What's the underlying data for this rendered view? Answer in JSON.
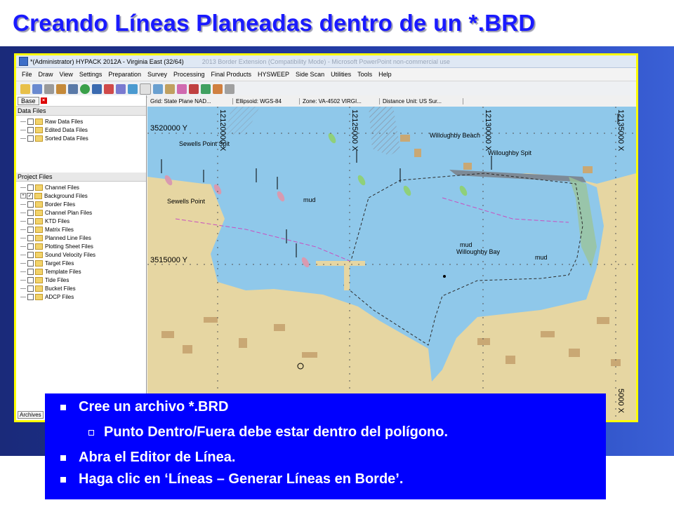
{
  "slide": {
    "title": "Creando Líneas Planeadas dentro de un *.BRD"
  },
  "window": {
    "title": "*(Administrator) HYPACK 2012A - Virginia East (32/64)",
    "background_caption": "2013 Border Extension (Compatibility Mode) - Microsoft PowerPoint non-commercial use"
  },
  "menu": [
    "File",
    "Draw",
    "View",
    "Settings",
    "Preparation",
    "Survey",
    "Processing",
    "Final Products",
    "HYSWEEP",
    "Side Scan",
    "Utilities",
    "Tools",
    "Help"
  ],
  "sidebar": {
    "tab_label": "Base",
    "data_files_label": "Data Files",
    "data_files": [
      "Raw Data Files",
      "Edited Data Files",
      "Sorted Data Files"
    ],
    "project_files_label": "Project Files",
    "project_files": [
      "Channel Files",
      "Background Files",
      "Border Files",
      "Channel Plan Files",
      "KTD Files",
      "Matrix Files",
      "Planned Line Files",
      "Plotting Sheet Files",
      "Sound Velocity Files",
      "Target Files",
      "Template Files",
      "Tide Files",
      "Bucket Files",
      "ADCP Files"
    ],
    "archives_tab": "Archives"
  },
  "statusbar": {
    "grid": "Grid: State Plane NAD...",
    "ellipsoid": "Ellipsoid: WGS-84",
    "zone": "Zone: VA-4502 VIRGI...",
    "distance_unit": "Distance Unit: US Sur..."
  },
  "map": {
    "y_labels": [
      "3520000 Y",
      "3515000 Y"
    ],
    "x_labels": [
      "12120000 X",
      "12125000 X",
      "12130000 X",
      "12135000 X"
    ],
    "x_label_bottom": "5000 X",
    "place_labels": [
      "Sewells Point Spit",
      "Willoughby Beach",
      "Willoughby Spit",
      "Sewells Point",
      "mud",
      "mud",
      "Willoughby Bay",
      "mud"
    ],
    "colors": {
      "water": "#8fc8ea",
      "land": "#e6d6a2",
      "border": "#2b2b2b",
      "magenta": "#c84fc0"
    }
  },
  "bullets": {
    "b1": "Cree un archivo *.BRD",
    "b1_sub": "Punto Dentro/Fuera debe estar dentro del polígono.",
    "b2": "Abra el Editor de Línea.",
    "b3": "Haga clic en ‘Líneas – Generar Líneas en Borde’."
  }
}
